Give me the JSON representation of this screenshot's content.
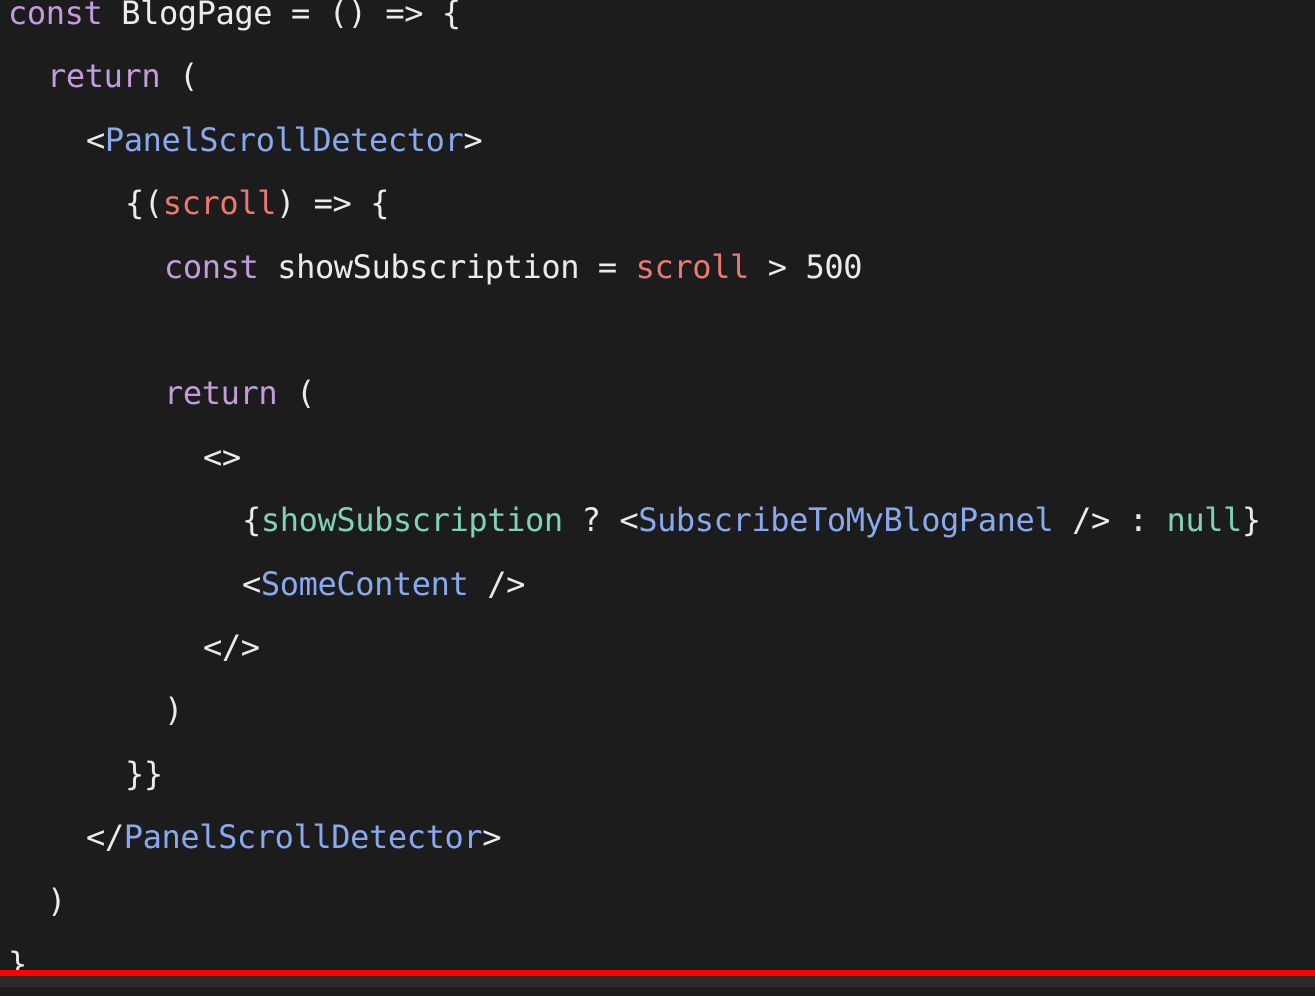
{
  "colors": {
    "background": "#1c1c1c",
    "keyword": "#c49bdc",
    "default": "#ebebeb",
    "component": "#88a8f0",
    "param": "#ee7770",
    "identifier": "#7fd2b8",
    "progress": "#ff0000"
  },
  "editor": {
    "lines": [
      {
        "indent": 0,
        "tokens": [
          {
            "t": "const",
            "c": "keyword"
          },
          {
            "t": " BlogPage = () => {",
            "c": "default"
          }
        ]
      },
      {
        "indent": 1,
        "tokens": [
          {
            "t": "return",
            "c": "keyword"
          },
          {
            "t": " (",
            "c": "default"
          }
        ]
      },
      {
        "indent": 2,
        "tokens": [
          {
            "t": "<",
            "c": "default"
          },
          {
            "t": "PanelScrollDetector",
            "c": "component"
          },
          {
            "t": ">",
            "c": "default"
          }
        ]
      },
      {
        "indent": 3,
        "tokens": [
          {
            "t": "{(",
            "c": "default"
          },
          {
            "t": "scroll",
            "c": "param"
          },
          {
            "t": ") => {",
            "c": "default"
          }
        ]
      },
      {
        "indent": 4,
        "tokens": [
          {
            "t": "const",
            "c": "keyword"
          },
          {
            "t": " showSubscription = ",
            "c": "default"
          },
          {
            "t": "scroll",
            "c": "param"
          },
          {
            "t": " > 500",
            "c": "default"
          }
        ]
      },
      {
        "indent": 0,
        "tokens": []
      },
      {
        "indent": 4,
        "tokens": [
          {
            "t": "return",
            "c": "keyword"
          },
          {
            "t": " (",
            "c": "default"
          }
        ]
      },
      {
        "indent": 5,
        "tokens": [
          {
            "t": "<>",
            "c": "default"
          }
        ]
      },
      {
        "indent": 6,
        "tokens": [
          {
            "t": "{",
            "c": "default"
          },
          {
            "t": "showSubscription",
            "c": "identifier"
          },
          {
            "t": " ? <",
            "c": "default"
          },
          {
            "t": "SubscribeToMyBlogPanel",
            "c": "component"
          },
          {
            "t": " /> : ",
            "c": "default"
          },
          {
            "t": "null",
            "c": "identifier"
          },
          {
            "t": "}",
            "c": "default"
          }
        ]
      },
      {
        "indent": 6,
        "tokens": [
          {
            "t": "<",
            "c": "default"
          },
          {
            "t": "SomeContent",
            "c": "component"
          },
          {
            "t": " />",
            "c": "default"
          }
        ]
      },
      {
        "indent": 5,
        "tokens": [
          {
            "t": "</>",
            "c": "default"
          }
        ]
      },
      {
        "indent": 4,
        "tokens": [
          {
            "t": ")",
            "c": "default"
          }
        ]
      },
      {
        "indent": 3,
        "tokens": [
          {
            "t": "}}",
            "c": "default"
          }
        ]
      },
      {
        "indent": 2,
        "tokens": [
          {
            "t": "</",
            "c": "default"
          },
          {
            "t": "PanelScrollDetector",
            "c": "component"
          },
          {
            "t": ">",
            "c": "default"
          }
        ]
      },
      {
        "indent": 1,
        "tokens": [
          {
            "t": ")",
            "c": "default"
          }
        ]
      },
      {
        "indent": 0,
        "tokens": [
          {
            "t": "}",
            "c": "default"
          }
        ]
      }
    ]
  },
  "video": {
    "progress_fraction": 1.0
  }
}
